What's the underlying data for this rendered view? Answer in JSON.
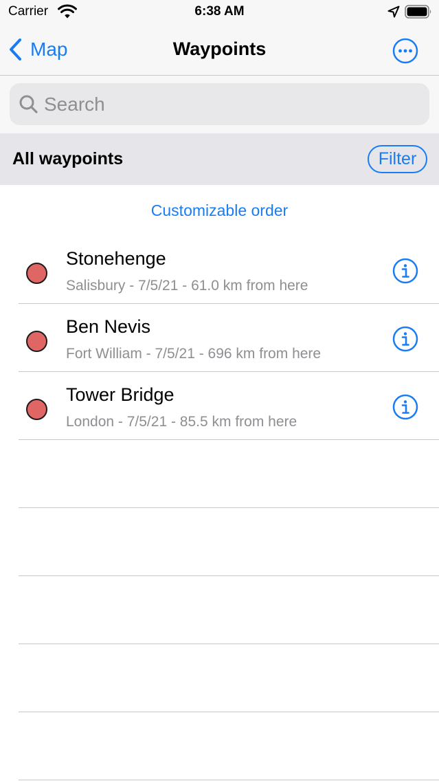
{
  "status_bar": {
    "carrier": "Carrier",
    "time": "6:38 AM"
  },
  "nav": {
    "back_label": "Map",
    "title": "Waypoints"
  },
  "search": {
    "placeholder": "Search",
    "value": ""
  },
  "section": {
    "title": "All waypoints",
    "filter_label": "Filter"
  },
  "order_label": "Customizable order",
  "waypoints": [
    {
      "name": "Stonehenge",
      "detail": "Salisbury - 7/5/21 - 61.0 km from here",
      "color": "#e06666"
    },
    {
      "name": "Ben Nevis",
      "detail": "Fort William - 7/5/21 - 696 km from here",
      "color": "#e06666"
    },
    {
      "name": "Tower Bridge",
      "detail": "London - 7/5/21 - 85.5 km from here",
      "color": "#e06666"
    }
  ],
  "colors": {
    "accent": "#1a7cf2",
    "secondary_text": "#8e8e93",
    "separator": "#c6c6c8"
  }
}
